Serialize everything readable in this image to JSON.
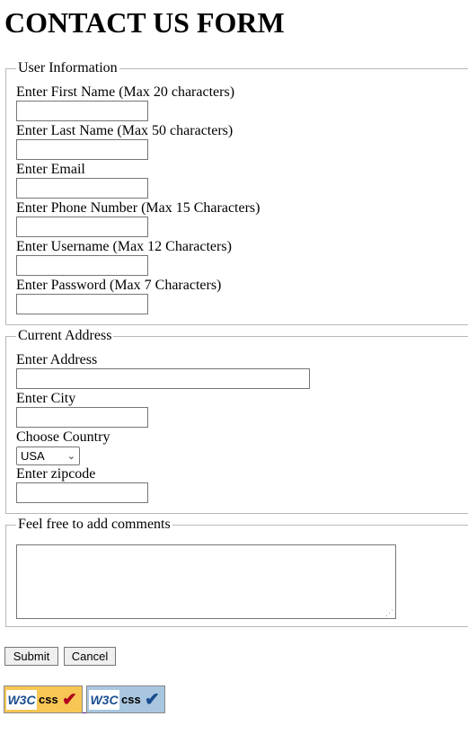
{
  "title": "CONTACT US FORM",
  "user_info": {
    "legend": "User Information",
    "first_name_label": "Enter First Name (Max 20 characters)",
    "last_name_label": "Enter Last Name (Max 50 characters)",
    "email_label": "Enter Email",
    "phone_label": "Enter Phone Number (Max 15 Characters)",
    "username_label": "Enter Username (Max 12 Characters)",
    "password_label": "Enter Password (Max 7 Characters)"
  },
  "address": {
    "legend": "Current Address",
    "address_label": "Enter Address",
    "city_label": "Enter City",
    "country_label": "Choose Country",
    "country_selected": "USA",
    "zip_label": "Enter zipcode"
  },
  "comments": {
    "legend": "Feel free to add comments"
  },
  "buttons": {
    "submit": "Submit",
    "cancel": "Cancel"
  },
  "badges": [
    {
      "w3": "W3C",
      "css": "css",
      "tick": "✔",
      "bg": "#f7c654",
      "tick_color": "#b3001b"
    },
    {
      "w3": "W3C",
      "css": "css",
      "tick": "✔",
      "bg": "#a9c6e0",
      "tick_color": "#1a4d8f"
    }
  ],
  "icons": {
    "select_chevron": "chevron-down-icon",
    "textarea_grip": "resize-grip-icon"
  }
}
